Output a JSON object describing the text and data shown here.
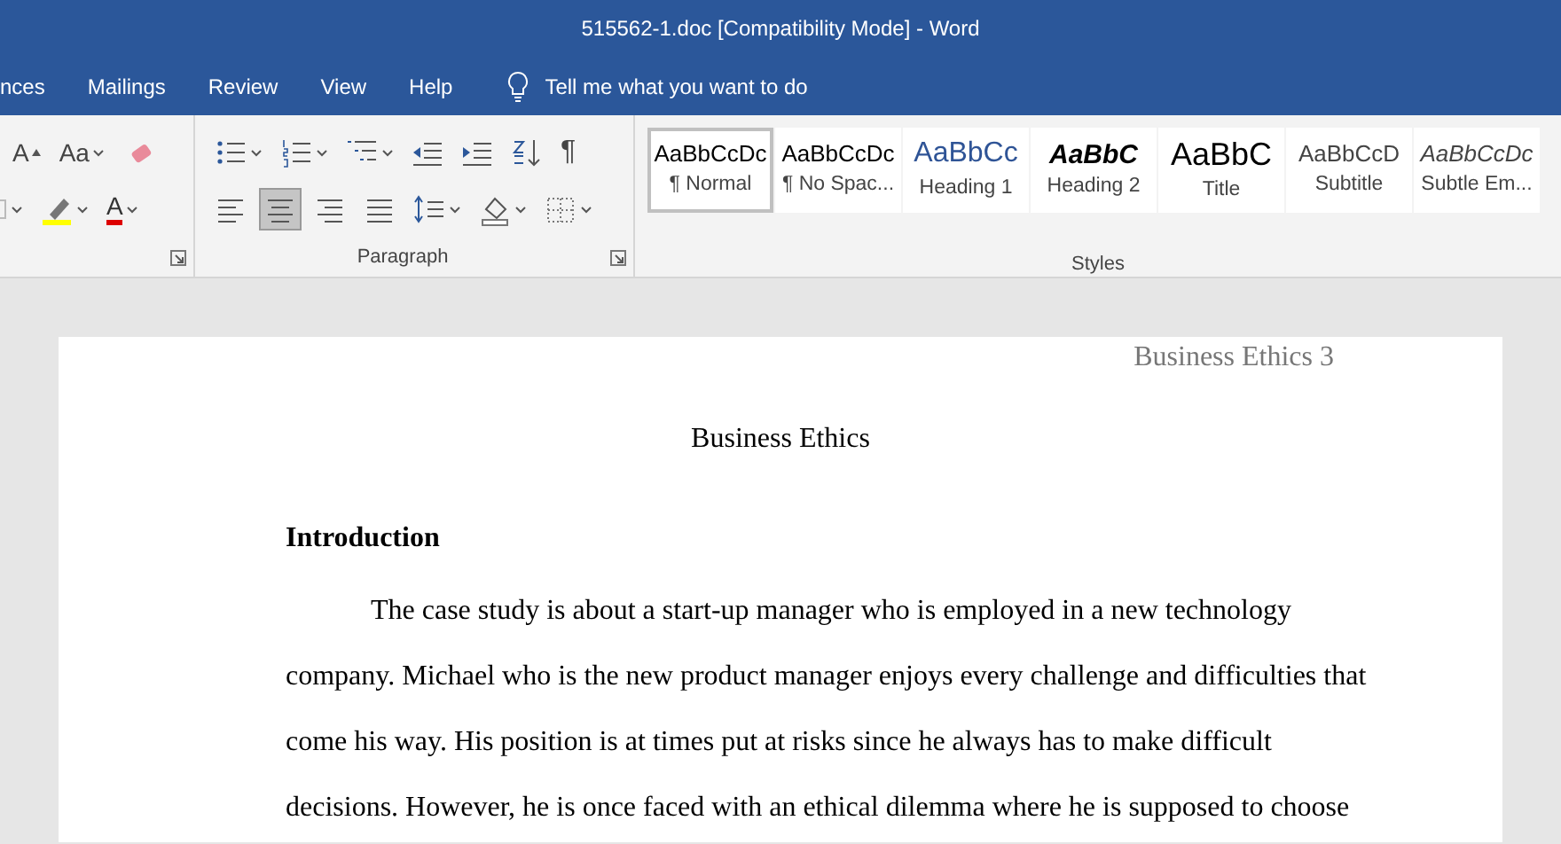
{
  "window": {
    "title": "515562-1.doc [Compatibility Mode]  -  Word"
  },
  "tabs": [
    {
      "label": "nces",
      "selected": false
    },
    {
      "label": "Mailings",
      "selected": false
    },
    {
      "label": "Review",
      "selected": false
    },
    {
      "label": "View",
      "selected": false
    },
    {
      "label": "Help",
      "selected": false
    }
  ],
  "tell_me": {
    "label": "Tell me what you want to do"
  },
  "font_group": {
    "row_1": [
      {
        "kind": "grow_font",
        "label": "A"
      },
      {
        "kind": "change_case",
        "label": "Aa"
      },
      {
        "kind": "clear_formatting"
      }
    ],
    "row_2": [
      {
        "kind": "cut_off"
      },
      {
        "kind": "highlight"
      },
      {
        "kind": "font_color",
        "label": "A"
      }
    ]
  },
  "paragraph_group": {
    "label": "Paragraph",
    "row_1": [
      {
        "kind": "bullets"
      },
      {
        "kind": "numbering"
      },
      {
        "kind": "multilevel"
      },
      {
        "kind": "decrease_indent"
      },
      {
        "kind": "increase_indent"
      },
      {
        "kind": "sort"
      },
      {
        "kind": "show_marks",
        "label": "¶"
      }
    ],
    "row_2": [
      {
        "kind": "align_left",
        "selected": false
      },
      {
        "kind": "align_center",
        "selected": true
      },
      {
        "kind": "align_right",
        "selected": false
      },
      {
        "kind": "justify",
        "selected": false
      },
      {
        "kind": "line_spacing"
      },
      {
        "kind": "shading"
      },
      {
        "kind": "borders"
      }
    ]
  },
  "styles_group": {
    "label": "Styles",
    "items": [
      {
        "kind": "normal",
        "preview": "AaBbCcDc",
        "label": "¶ Normal",
        "selected": true
      },
      {
        "kind": "no_spacing",
        "preview": "AaBbCcDc",
        "label": "¶ No Spac...",
        "selected": false
      },
      {
        "kind": "heading_1",
        "preview": "AaBbCc",
        "label": "Heading 1",
        "selected": false
      },
      {
        "kind": "heading_2",
        "preview": "AaBbC",
        "label": "Heading 2",
        "selected": false
      },
      {
        "kind": "title",
        "preview": "AaBbC",
        "label": "Title",
        "selected": false
      },
      {
        "kind": "subtitle",
        "preview": "AaBbCcD",
        "label": "Subtitle",
        "selected": false
      },
      {
        "kind": "subtle_emphasis",
        "preview": "AaBbCcDc",
        "label": "Subtle Em...",
        "selected": false
      }
    ]
  },
  "document": {
    "header": "Business Ethics 3",
    "title": "Business Ethics",
    "heading": "Introduction",
    "paragraph": "The case study is about a start-up manager who is employed in a new technology company. Michael who is the new product manager enjoys every challenge and difficulties that come his way. His position is at times put at risks since he always has to make difficult decisions. However, he is once faced with an ethical dilemma where he is supposed to choose"
  }
}
